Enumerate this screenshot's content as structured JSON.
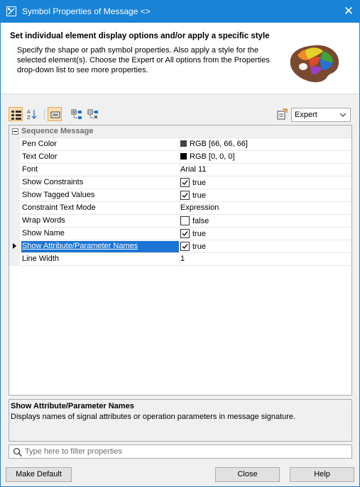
{
  "window": {
    "title": "Symbol Properties of Message <>",
    "close_glyph": "✕"
  },
  "header": {
    "title": "Set individual element display options and/or apply a specific style",
    "description": "Specify the shape or path symbol properties. Also apply a style for the selected element(s). Choose the Expert or All options from the Properties drop-down list to see more properties."
  },
  "toolbar": {
    "mode_value": "Expert",
    "icons": [
      "categorized-view-icon",
      "sort-alphabetical-icon",
      "show-description-icon",
      "expand-all-icon",
      "collapse-all-icon",
      "apply-style-icon"
    ]
  },
  "properties": {
    "group_label": "Sequence Message",
    "rows": [
      {
        "name": "Pen Color",
        "value": "RGB [66, 66, 66]",
        "swatch": "#424242"
      },
      {
        "name": "Text Color",
        "value": "RGB [0, 0, 0]",
        "swatch": "#000000"
      },
      {
        "name": "Font",
        "value": "Arial 11"
      },
      {
        "name": "Show Constraints",
        "value": "true",
        "checked": true
      },
      {
        "name": "Show Tagged Values",
        "value": "true",
        "checked": true
      },
      {
        "name": "Constraint Text Mode",
        "value": "Expression"
      },
      {
        "name": "Wrap Words",
        "value": "false",
        "checked": false
      },
      {
        "name": "Show Name",
        "value": "true",
        "checked": true
      },
      {
        "name": "Show Attribute/Parameter Names",
        "value": "true",
        "checked": true,
        "selected": true
      },
      {
        "name": "Line Width",
        "value": "1"
      }
    ]
  },
  "description_panel": {
    "title": "Show Attribute/Parameter Names",
    "text": "Displays names of signal attributes or operation parameters in message signature."
  },
  "filter": {
    "placeholder": "Type here to filter properties",
    "value": ""
  },
  "buttons": {
    "make_default": "Make Default",
    "close": "Close",
    "help": "Help"
  },
  "colors": {
    "titlebar": "#1883d7",
    "selection": "#1c74d4",
    "active_tool": "#f8ddb0"
  }
}
